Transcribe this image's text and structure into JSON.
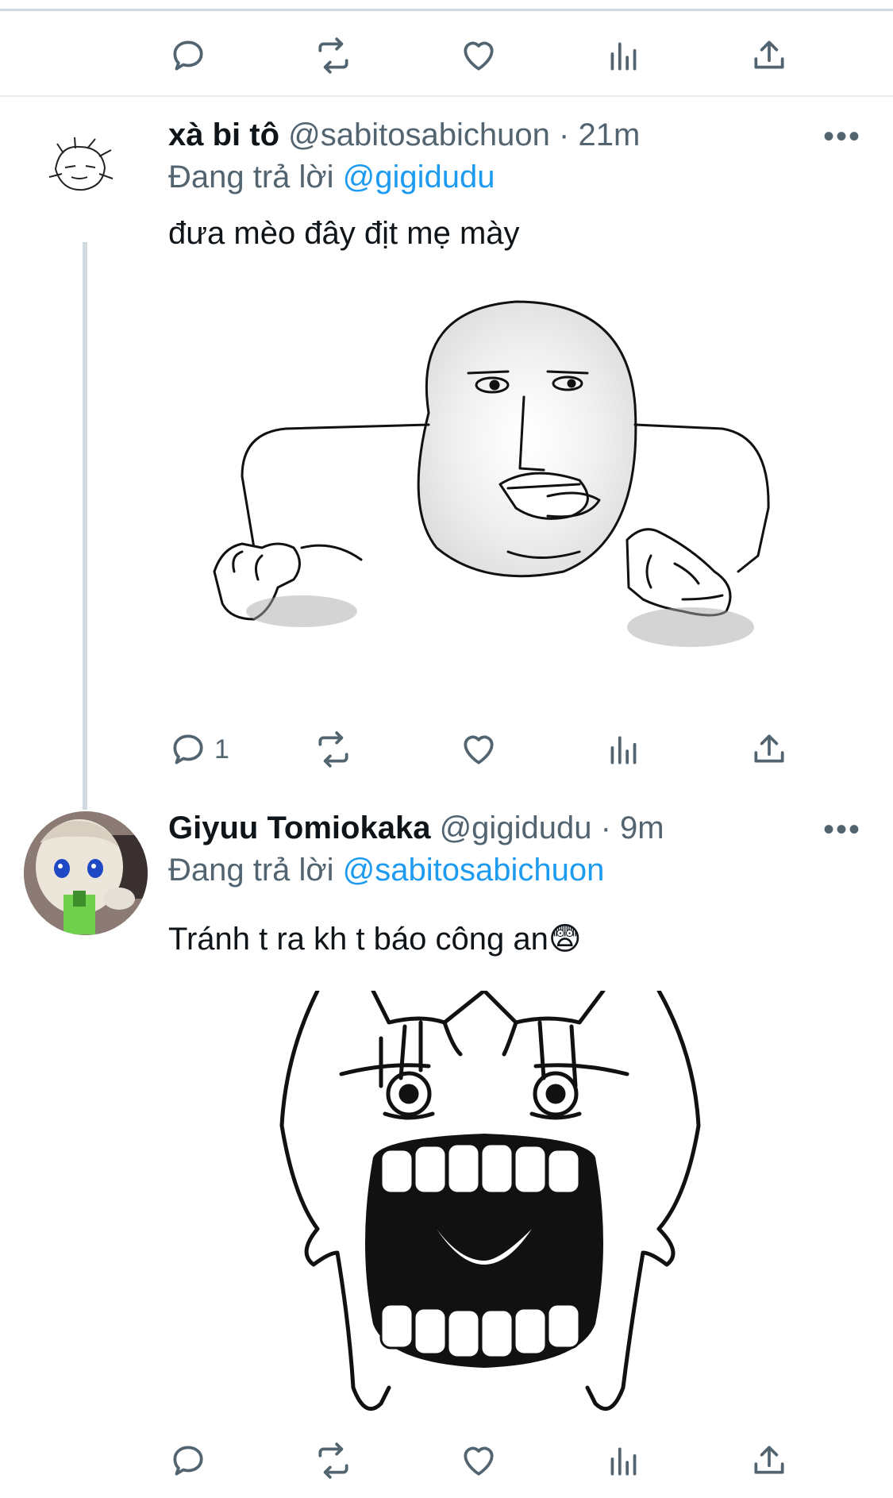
{
  "tweets": [
    {
      "display_name": "xà bi tô",
      "handle": "@sabitosabichuon",
      "separator": "·",
      "time": "21m",
      "replying_prefix": "Đang trả lời",
      "replying_to": "@gigidudu",
      "text": "đưa mèo đây địt mẹ mày",
      "more": "•••",
      "reply_count": "1"
    },
    {
      "display_name": "Giyuu Tomiokaka",
      "handle": "@gigidudu",
      "separator": "·",
      "time": "9m",
      "replying_prefix": "Đang trả lời",
      "replying_to": "@sabitosabichuon",
      "text": "Tránh t ra kh t báo công an",
      "emoji": "😨",
      "more": "•••",
      "reply_count": ""
    }
  ],
  "icons": [
    "reply-icon",
    "retweet-icon",
    "like-icon",
    "analytics-icon",
    "share-icon"
  ],
  "colors": {
    "link": "#1d9bf0",
    "secondary": "#536471",
    "divider": "#e6ecf0"
  }
}
